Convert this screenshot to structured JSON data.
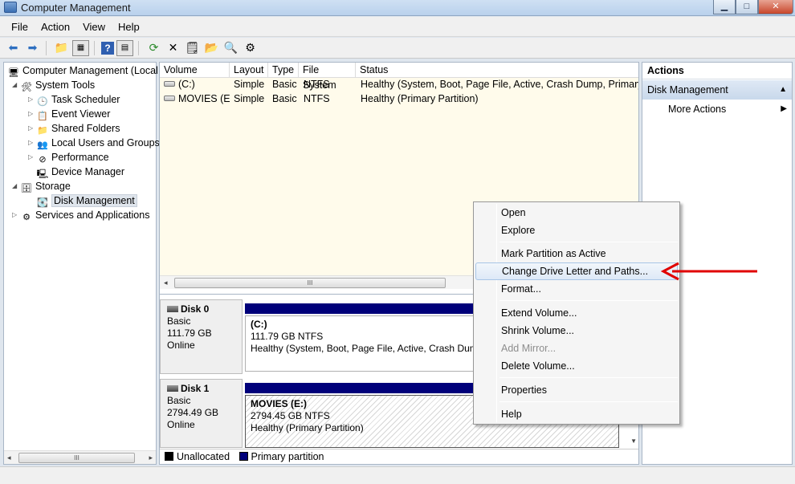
{
  "window": {
    "title": "Computer Management"
  },
  "menu": [
    "File",
    "Action",
    "View",
    "Help"
  ],
  "tree": {
    "root": "Computer Management (Local",
    "items": [
      {
        "label": "System Tools",
        "level": 1,
        "expanded": true,
        "icon": "tools-icon"
      },
      {
        "label": "Task Scheduler",
        "level": 2,
        "icon": "clock-icon"
      },
      {
        "label": "Event Viewer",
        "level": 2,
        "icon": "event-viewer-icon"
      },
      {
        "label": "Shared Folders",
        "level": 2,
        "icon": "shared-folder-icon"
      },
      {
        "label": "Local Users and Groups",
        "level": 2,
        "icon": "users-icon"
      },
      {
        "label": "Performance",
        "level": 2,
        "icon": "performance-icon"
      },
      {
        "label": "Device Manager",
        "level": 2,
        "icon": "device-manager-icon"
      },
      {
        "label": "Storage",
        "level": 1,
        "expanded": true,
        "icon": "storage-icon"
      },
      {
        "label": "Disk Management",
        "level": 2,
        "icon": "disk-management-icon",
        "selected": true
      },
      {
        "label": "Services and Applications",
        "level": 1,
        "icon": "services-icon"
      }
    ]
  },
  "volumes": {
    "headers": [
      "Volume",
      "Layout",
      "Type",
      "File System",
      "Status"
    ],
    "rows": [
      [
        "(C:)",
        "Simple",
        "Basic",
        "NTFS",
        "Healthy (System, Boot, Page File, Active, Crash Dump, Primary Pa"
      ],
      [
        "MOVIES (E:)",
        "Simple",
        "Basic",
        "NTFS",
        "Healthy (Primary Partition)"
      ]
    ]
  },
  "disks": [
    {
      "name": "Disk 0",
      "type": "Basic",
      "size": "111.79 GB",
      "state": "Online",
      "partition": {
        "name": "(C:)",
        "detail": "111.79 GB NTFS",
        "status": "Healthy (System, Boot, Page File, Active, Crash Dump"
      }
    },
    {
      "name": "Disk 1",
      "type": "Basic",
      "size": "2794.49 GB",
      "state": "Online",
      "partition": {
        "name": "MOVIES  (E:)",
        "detail": "2794.45 GB NTFS",
        "status": "Healthy (Primary Partition)"
      }
    }
  ],
  "legend": {
    "unallocated": "Unallocated",
    "primary": "Primary partition"
  },
  "actions": {
    "title": "Actions",
    "section": "Disk Management",
    "more": "More Actions"
  },
  "context_menu": [
    {
      "label": "Open"
    },
    {
      "label": "Explore"
    },
    {
      "sep": true
    },
    {
      "label": "Mark Partition as Active"
    },
    {
      "label": "Change Drive Letter and Paths...",
      "highlighted": true
    },
    {
      "label": "Format..."
    },
    {
      "sep": true
    },
    {
      "label": "Extend Volume..."
    },
    {
      "label": "Shrink Volume..."
    },
    {
      "label": "Add Mirror...",
      "disabled": true
    },
    {
      "label": "Delete Volume..."
    },
    {
      "sep": true
    },
    {
      "label": "Properties"
    },
    {
      "sep": true
    },
    {
      "label": "Help"
    }
  ],
  "colors": {
    "primary_partition": "#00007a",
    "annotation_arrow": "#e00000",
    "actions_header": "#c8d8eb"
  }
}
